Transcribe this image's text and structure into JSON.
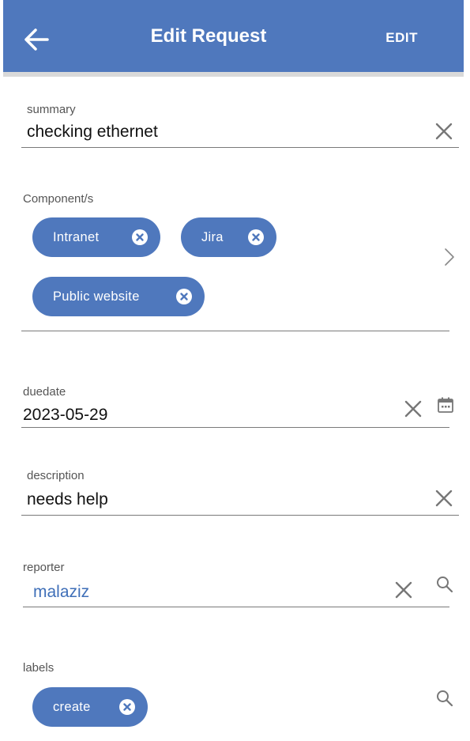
{
  "header": {
    "title": "Edit Request",
    "edit_label": "EDIT"
  },
  "fields": {
    "summary": {
      "label": "summary",
      "value": "checking ethernet"
    },
    "components": {
      "label": "Component/s",
      "chips": [
        "Intranet",
        "Jira",
        "Public website"
      ]
    },
    "duedate": {
      "label": "duedate",
      "value": "2023-05-29"
    },
    "description": {
      "label": "description",
      "value": "needs help"
    },
    "reporter": {
      "label": "reporter",
      "value": "malaziz"
    },
    "labels": {
      "label": "labels",
      "chips": [
        "create"
      ]
    }
  },
  "colors": {
    "primary": "#4f78bd",
    "link": "#3f6fb8",
    "icon": "#777777"
  },
  "icons": [
    "arrow-left",
    "close",
    "calendar",
    "search",
    "chevron-right",
    "chip-close"
  ]
}
